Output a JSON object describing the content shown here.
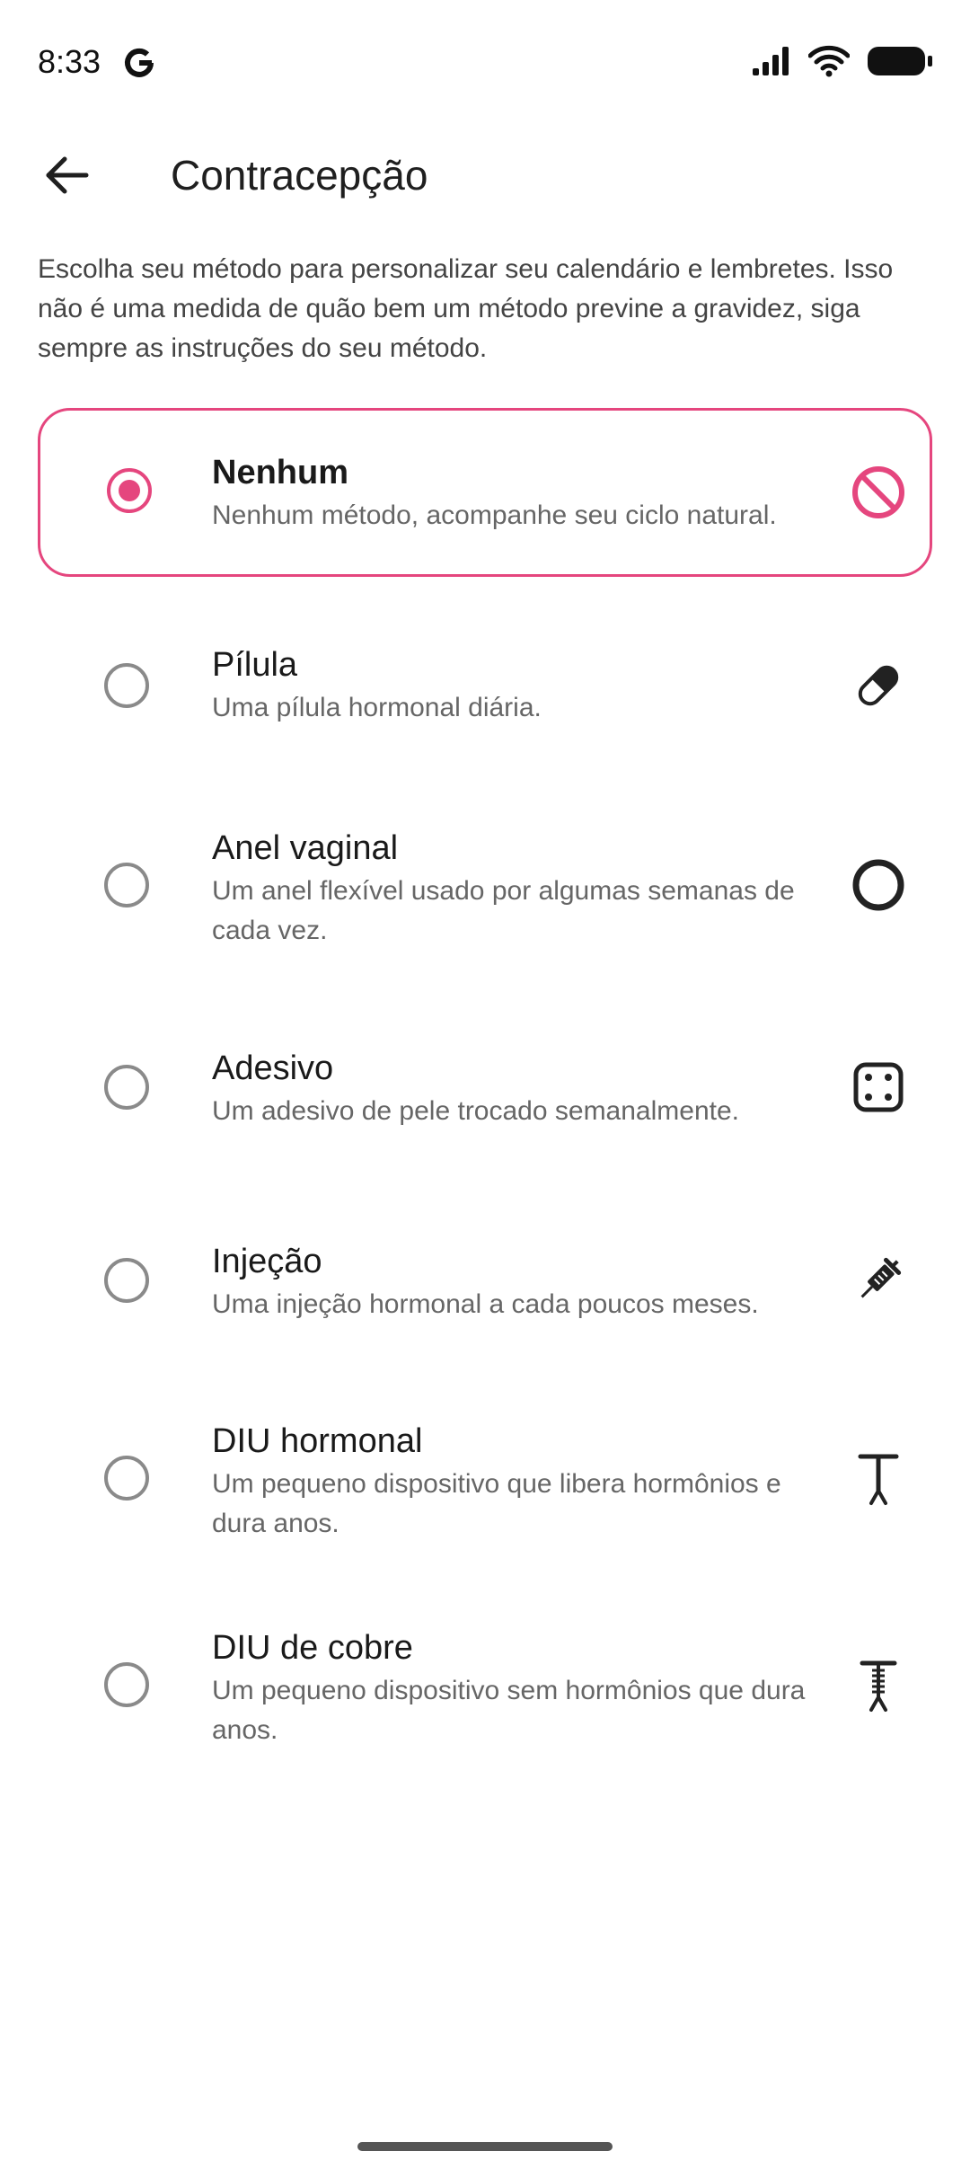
{
  "status_bar": {
    "time": "8:33"
  },
  "header": {
    "title": "Contracepção"
  },
  "description": "Escolha seu método para personalizar seu calendário e lembretes. Isso não é uma medida de quão bem um método previne a gravidez,  siga sempre as instruções do seu método.",
  "accent_color": "#e5467e",
  "options": [
    {
      "name": "Nenhum",
      "desc": "Nenhum método,  acompanhe seu ciclo natural.",
      "icon": "no-entry-icon",
      "selected": true
    },
    {
      "name": "Pílula",
      "desc": "Uma pílula hormonal diária.",
      "icon": "pill-icon",
      "selected": false
    },
    {
      "name": "Anel vaginal",
      "desc": "Um anel flexível usado por algumas semanas de cada vez.",
      "icon": "ring-icon",
      "selected": false
    },
    {
      "name": "Adesivo",
      "desc": "Um adesivo de pele trocado semanalmente.",
      "icon": "patch-icon",
      "selected": false
    },
    {
      "name": "Injeção",
      "desc": "Uma injeção hormonal a cada poucos meses.",
      "icon": "syringe-icon",
      "selected": false
    },
    {
      "name": "DIU hormonal",
      "desc": "Um pequeno dispositivo que libera hormônios e dura anos.",
      "icon": "hormonal-iud-icon",
      "selected": false
    },
    {
      "name": "DIU de cobre",
      "desc": "Um pequeno dispositivo sem hormônios que dura anos.",
      "icon": "copper-iud-icon",
      "selected": false
    }
  ]
}
